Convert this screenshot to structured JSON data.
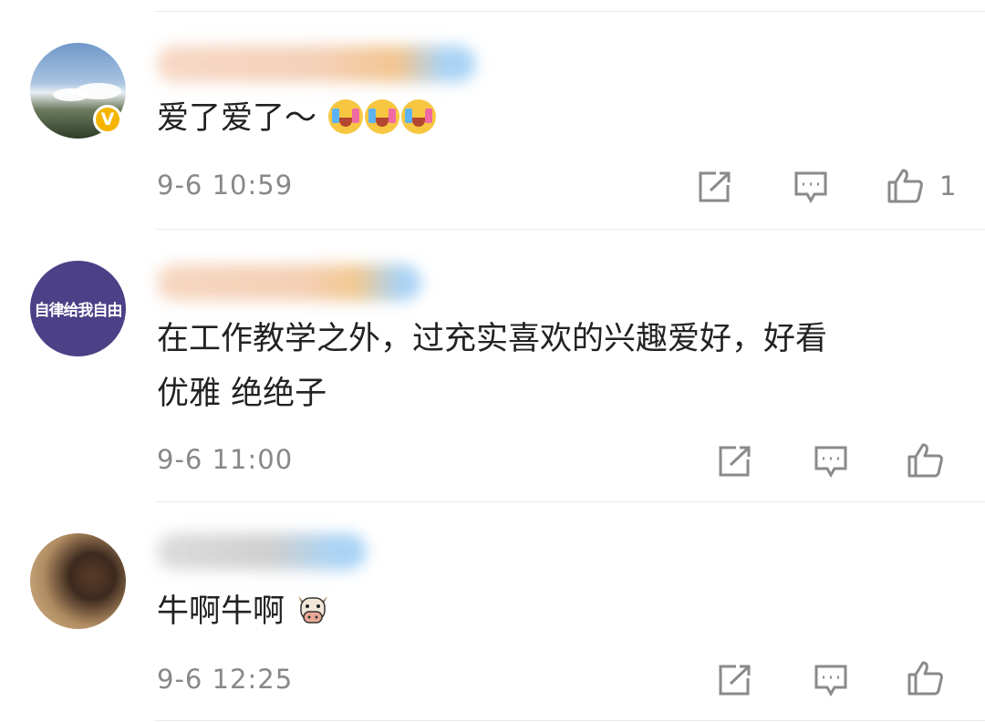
{
  "comments": [
    {
      "id": "c1",
      "avatar_verified": true,
      "avatar_badge": "V",
      "content": "爱了爱了～",
      "content_emojis": [
        "crying-laughing-emoji",
        "crying-laughing-emoji",
        "crying-laughing-emoji"
      ],
      "time": "9-6 10:59",
      "likes": "1"
    },
    {
      "id": "c2",
      "avatar_text": "自律给我自由",
      "content_lines": [
        "在工作教学之外，过充实喜欢的兴趣爱好，好看",
        "优雅 绝绝子"
      ],
      "time": "9-6 11:00",
      "likes": ""
    },
    {
      "id": "c3",
      "content": "牛啊牛啊",
      "content_emojis": [
        "cow-emoji"
      ],
      "time": "9-6 12:25",
      "likes": ""
    }
  ],
  "icons": {
    "share": "share-icon",
    "reply": "comment-icon",
    "like": "thumbs-up-icon"
  },
  "colors": {
    "text": "#222222",
    "meta": "#888888",
    "icon": "#8a8a8a",
    "verified_badge": "#f5b400",
    "divider": "#ececec"
  }
}
